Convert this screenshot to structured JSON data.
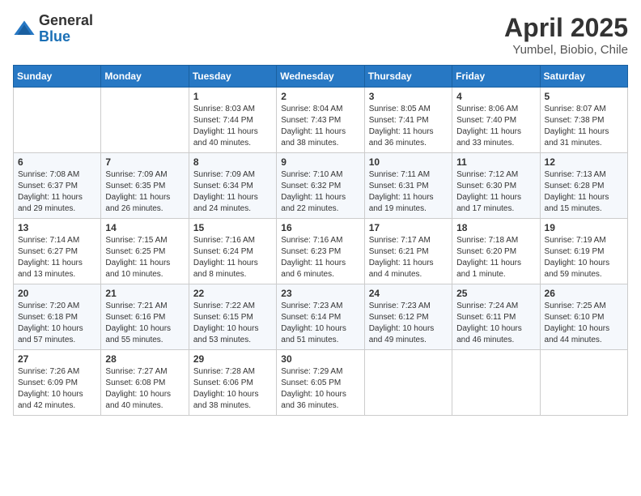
{
  "header": {
    "logo_general": "General",
    "logo_blue": "Blue",
    "month_year": "April 2025",
    "location": "Yumbel, Biobio, Chile"
  },
  "columns": [
    "Sunday",
    "Monday",
    "Tuesday",
    "Wednesday",
    "Thursday",
    "Friday",
    "Saturday"
  ],
  "weeks": [
    [
      {
        "day": "",
        "info": ""
      },
      {
        "day": "",
        "info": ""
      },
      {
        "day": "1",
        "info": "Sunrise: 8:03 AM\nSunset: 7:44 PM\nDaylight: 11 hours and 40 minutes."
      },
      {
        "day": "2",
        "info": "Sunrise: 8:04 AM\nSunset: 7:43 PM\nDaylight: 11 hours and 38 minutes."
      },
      {
        "day": "3",
        "info": "Sunrise: 8:05 AM\nSunset: 7:41 PM\nDaylight: 11 hours and 36 minutes."
      },
      {
        "day": "4",
        "info": "Sunrise: 8:06 AM\nSunset: 7:40 PM\nDaylight: 11 hours and 33 minutes."
      },
      {
        "day": "5",
        "info": "Sunrise: 8:07 AM\nSunset: 7:38 PM\nDaylight: 11 hours and 31 minutes."
      }
    ],
    [
      {
        "day": "6",
        "info": "Sunrise: 7:08 AM\nSunset: 6:37 PM\nDaylight: 11 hours and 29 minutes."
      },
      {
        "day": "7",
        "info": "Sunrise: 7:09 AM\nSunset: 6:35 PM\nDaylight: 11 hours and 26 minutes."
      },
      {
        "day": "8",
        "info": "Sunrise: 7:09 AM\nSunset: 6:34 PM\nDaylight: 11 hours and 24 minutes."
      },
      {
        "day": "9",
        "info": "Sunrise: 7:10 AM\nSunset: 6:32 PM\nDaylight: 11 hours and 22 minutes."
      },
      {
        "day": "10",
        "info": "Sunrise: 7:11 AM\nSunset: 6:31 PM\nDaylight: 11 hours and 19 minutes."
      },
      {
        "day": "11",
        "info": "Sunrise: 7:12 AM\nSunset: 6:30 PM\nDaylight: 11 hours and 17 minutes."
      },
      {
        "day": "12",
        "info": "Sunrise: 7:13 AM\nSunset: 6:28 PM\nDaylight: 11 hours and 15 minutes."
      }
    ],
    [
      {
        "day": "13",
        "info": "Sunrise: 7:14 AM\nSunset: 6:27 PM\nDaylight: 11 hours and 13 minutes."
      },
      {
        "day": "14",
        "info": "Sunrise: 7:15 AM\nSunset: 6:25 PM\nDaylight: 11 hours and 10 minutes."
      },
      {
        "day": "15",
        "info": "Sunrise: 7:16 AM\nSunset: 6:24 PM\nDaylight: 11 hours and 8 minutes."
      },
      {
        "day": "16",
        "info": "Sunrise: 7:16 AM\nSunset: 6:23 PM\nDaylight: 11 hours and 6 minutes."
      },
      {
        "day": "17",
        "info": "Sunrise: 7:17 AM\nSunset: 6:21 PM\nDaylight: 11 hours and 4 minutes."
      },
      {
        "day": "18",
        "info": "Sunrise: 7:18 AM\nSunset: 6:20 PM\nDaylight: 11 hours and 1 minute."
      },
      {
        "day": "19",
        "info": "Sunrise: 7:19 AM\nSunset: 6:19 PM\nDaylight: 10 hours and 59 minutes."
      }
    ],
    [
      {
        "day": "20",
        "info": "Sunrise: 7:20 AM\nSunset: 6:18 PM\nDaylight: 10 hours and 57 minutes."
      },
      {
        "day": "21",
        "info": "Sunrise: 7:21 AM\nSunset: 6:16 PM\nDaylight: 10 hours and 55 minutes."
      },
      {
        "day": "22",
        "info": "Sunrise: 7:22 AM\nSunset: 6:15 PM\nDaylight: 10 hours and 53 minutes."
      },
      {
        "day": "23",
        "info": "Sunrise: 7:23 AM\nSunset: 6:14 PM\nDaylight: 10 hours and 51 minutes."
      },
      {
        "day": "24",
        "info": "Sunrise: 7:23 AM\nSunset: 6:12 PM\nDaylight: 10 hours and 49 minutes."
      },
      {
        "day": "25",
        "info": "Sunrise: 7:24 AM\nSunset: 6:11 PM\nDaylight: 10 hours and 46 minutes."
      },
      {
        "day": "26",
        "info": "Sunrise: 7:25 AM\nSunset: 6:10 PM\nDaylight: 10 hours and 44 minutes."
      }
    ],
    [
      {
        "day": "27",
        "info": "Sunrise: 7:26 AM\nSunset: 6:09 PM\nDaylight: 10 hours and 42 minutes."
      },
      {
        "day": "28",
        "info": "Sunrise: 7:27 AM\nSunset: 6:08 PM\nDaylight: 10 hours and 40 minutes."
      },
      {
        "day": "29",
        "info": "Sunrise: 7:28 AM\nSunset: 6:06 PM\nDaylight: 10 hours and 38 minutes."
      },
      {
        "day": "30",
        "info": "Sunrise: 7:29 AM\nSunset: 6:05 PM\nDaylight: 10 hours and 36 minutes."
      },
      {
        "day": "",
        "info": ""
      },
      {
        "day": "",
        "info": ""
      },
      {
        "day": "",
        "info": ""
      }
    ]
  ]
}
